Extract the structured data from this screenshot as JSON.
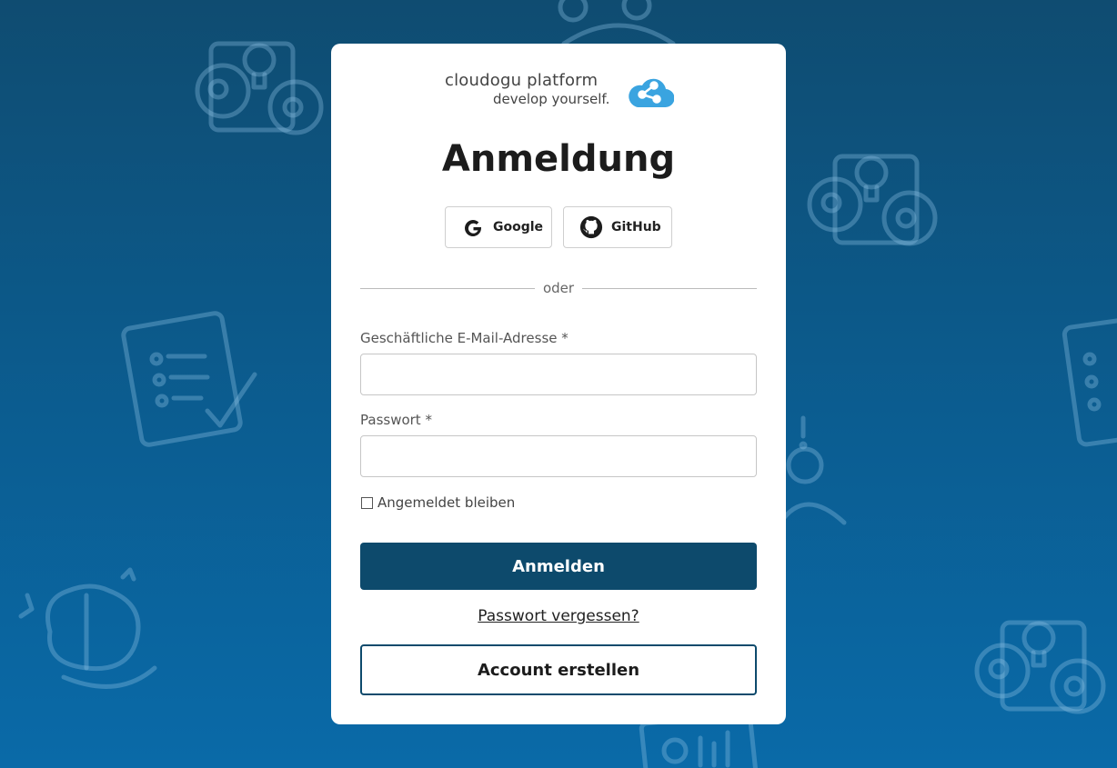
{
  "logo": {
    "name": "cloudogu platform",
    "tagline": "develop yourself."
  },
  "title": "Anmeldung",
  "sso": {
    "google": "Google",
    "github": "GitHub"
  },
  "divider": "oder",
  "email": {
    "label": "Geschäftliche E-Mail-Adresse *",
    "value": ""
  },
  "password": {
    "label": "Passwort *",
    "value": ""
  },
  "remember": {
    "label": "Angemeldet bleiben",
    "checked": false
  },
  "submit_label": "Anmelden",
  "forgot_label": "Passwort vergessen?",
  "create_account_label": "Account erstellen",
  "colors": {
    "primary": "#0d4a6c",
    "logo_cloud": "#3aa4e0"
  }
}
